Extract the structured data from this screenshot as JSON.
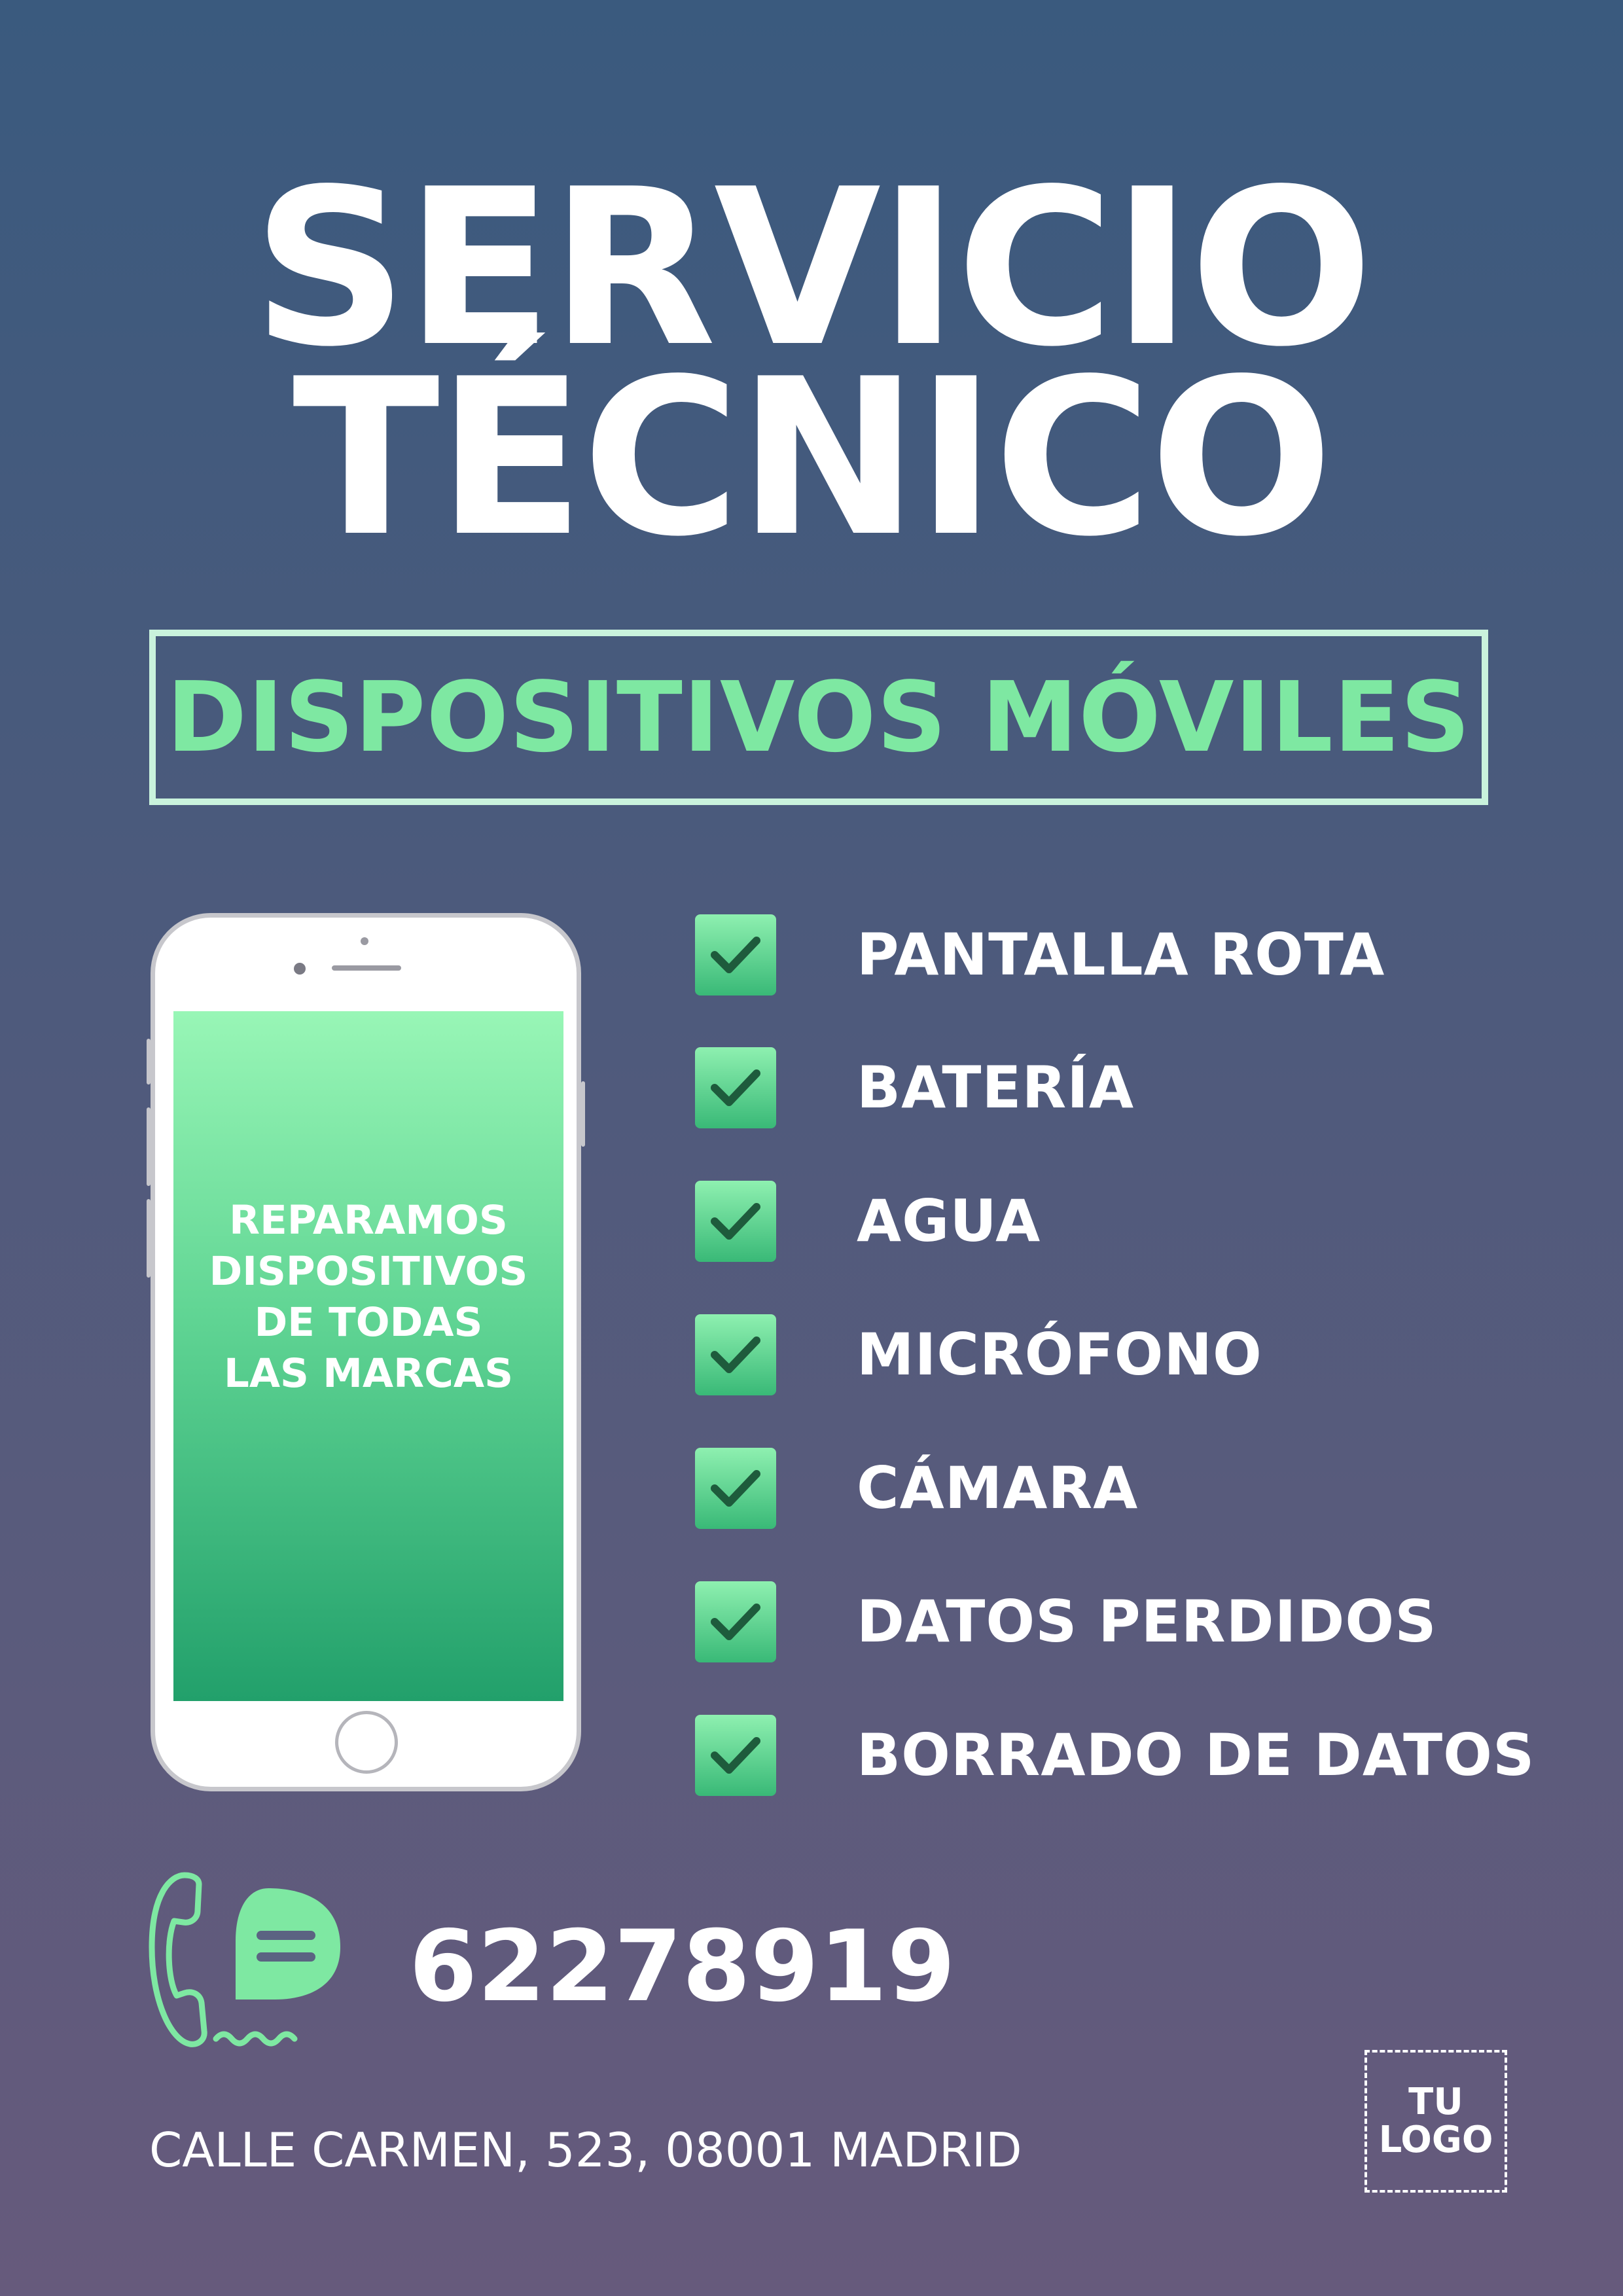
{
  "title": {
    "line1": "SERVICIO",
    "line2": "TÉCNICO"
  },
  "subtitle": "DISPOSITIVOS MÓVILES",
  "phone_screen": {
    "lines": [
      "REPARAMOS",
      "DISPOSITIVOS",
      "DE TODAS",
      "LAS MARCAS"
    ]
  },
  "services": [
    {
      "label": "PANTALLA ROTA"
    },
    {
      "label": "BATERÍA"
    },
    {
      "label": "AGUA"
    },
    {
      "label": "MICRÓFONO"
    },
    {
      "label": "CÁMARA"
    },
    {
      "label": "DATOS PERDIDOS"
    },
    {
      "label": "BORRADO DE DATOS"
    }
  ],
  "contact": {
    "phone": "62278919",
    "icon": "phone-chat-icon",
    "address": "CALLE CARMEN, 523, 08001 MADRID"
  },
  "logo": {
    "line1": "TU",
    "line2": "LOGO"
  },
  "colors": {
    "background_top": "#3a5a7e",
    "background_bottom": "#665a7c",
    "accent_green": "#7ee8a2",
    "box_border": "#c9f2dc",
    "check_dark": "#1e5b3c"
  }
}
